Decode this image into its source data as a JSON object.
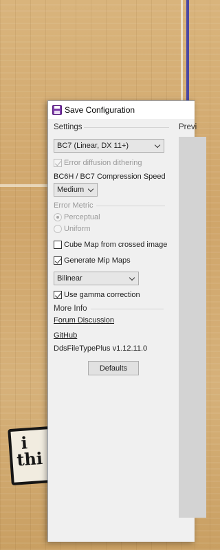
{
  "window": {
    "title": "Save Configuration"
  },
  "settings": {
    "section_label": "Settings",
    "format_value": "BC7 (Linear, DX 11+)",
    "error_diffusion_label": "Error diffusion dithering",
    "error_diffusion_checked": true,
    "compression_speed_label": "BC6H / BC7 Compression Speed",
    "compression_speed_value": "Medium",
    "error_metric_label": "Error Metric",
    "metric_options": [
      "Perceptual",
      "Uniform"
    ],
    "metric_selected": "Perceptual",
    "cube_map_label": "Cube Map from crossed image",
    "cube_map_checked": false,
    "mip_maps_label": "Generate Mip Maps",
    "mip_maps_checked": true,
    "mip_filter_value": "Bilinear",
    "gamma_label": "Use gamma correction",
    "gamma_checked": true
  },
  "more_info": {
    "section_label": "More Info",
    "forum_link": "Forum Discussion",
    "github_link": "GitHub",
    "version": "DdsFileTypePlus v1.12.11.0"
  },
  "defaults_button": "Defaults",
  "preview": {
    "section_label": "Previ"
  },
  "background_logo": {
    "line1": "i",
    "line2": "thi"
  },
  "colors": {
    "window_bg": "#f0f0f0",
    "preview_bg": "#d3d3d3",
    "court_line_blue": "#4a47a3"
  }
}
